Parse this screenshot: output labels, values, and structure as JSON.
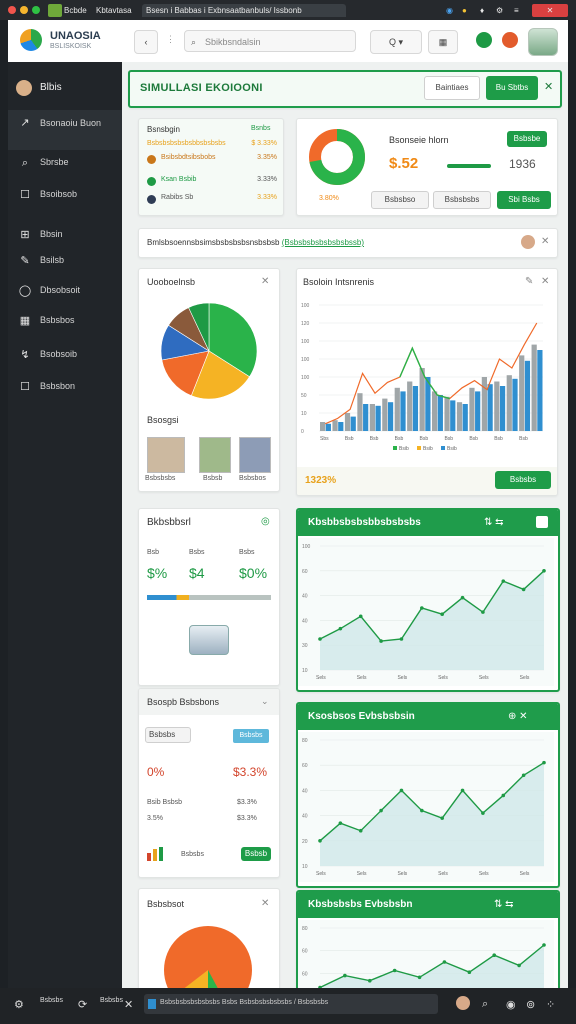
{
  "browser": {
    "tabs": [
      "Bcbde",
      "Kbtavtasa",
      "Bsesn i Babbas i Exbnsaatbanbuls/ Issbonb"
    ],
    "right_icons": [
      "globe-icon",
      "github-icon",
      "bell-icon",
      "settings-icon",
      "menu-icon"
    ],
    "window_close": "✕"
  },
  "app": {
    "logo_title": "UNAOSIA",
    "logo_subtitle": "BSLISKOISK",
    "back_label": "‹",
    "search_placeholder": "Sbikbsndalsin",
    "filter_label": "Q ▾",
    "grid_label": "▦",
    "header_icons": [
      "person-icon",
      "help-icon",
      "car-avatar"
    ]
  },
  "sidebar": {
    "user_label": "Blbis",
    "items": [
      {
        "label": "Bsonaoiu Buon",
        "icon": "↗"
      },
      {
        "label": "Sbrsbe",
        "icon": "⌕"
      },
      {
        "label": "Bsoibsob",
        "icon": "☐"
      },
      {
        "label": "Bbsin",
        "icon": "⊞"
      },
      {
        "label": "Bsilsb",
        "icon": "✎"
      },
      {
        "label": "Dbsobsoit",
        "icon": "◯"
      },
      {
        "label": "Bsbsbos",
        "icon": "▦"
      },
      {
        "label": "Bsobsoib",
        "icon": "↯"
      },
      {
        "label": "Bsbsbon",
        "icon": "☐"
      }
    ]
  },
  "header_bar": {
    "title": "SIMULLASI EKOIOONI",
    "btn1": "Baintiaes",
    "btn2": "Bu Sbtbs",
    "close": "✕"
  },
  "summary_list": {
    "title": "Bsnsbgin",
    "col": "Bsnbs",
    "rows": [
      {
        "label": "Bsbsbsbsbsbsbbsbsbsbs",
        "value": "$ 3.33%",
        "color": "#e8a21c"
      },
      {
        "label": "Bsibsbdtsibsbobs",
        "value": "3.35%",
        "color": "#c9771a"
      },
      {
        "label": "Ksan Bsbib",
        "value": "3.33%",
        "color": "#1e9a45"
      },
      {
        "label": "Rabibs Sb",
        "value": "3.33%",
        "color": "#333"
      }
    ]
  },
  "kpi_card": {
    "title": "Bsonseie hlorn",
    "value": "$.52",
    "right_value": "1936",
    "button": "Bsbsbe",
    "donut_label": "3.80%",
    "actions": [
      "Bsbsbso",
      "Bsbsbsbs",
      "Sbi Bsbs"
    ],
    "donut_fraction": 0.72
  },
  "notification": {
    "text": "Bmlsbsoennsbsimsbsbsbsbsnsbsbsb",
    "link": "(Bsbsbsbsbsbsbsbssb)",
    "close": "✕"
  },
  "pie_card": {
    "title": "Uooboelnsb",
    "close": "✕",
    "subtitle": "Bsosgsi",
    "people": [
      "Bsbsbsbs",
      "Bsbsb",
      "Bsbsbos"
    ],
    "slices": [
      {
        "value": 34,
        "color": "#2ab34a"
      },
      {
        "value": 22,
        "color": "#f5b324"
      },
      {
        "value": 16,
        "color": "#f06a2a"
      },
      {
        "value": 12,
        "color": "#2f6cc0"
      },
      {
        "value": 9,
        "color": "#8a5a3b"
      },
      {
        "value": 7,
        "color": "#1e9a45"
      }
    ]
  },
  "combo_chart": {
    "title": "Bsoloin Intsnrenis",
    "footer_value": "1323%",
    "footer_button": "Bsbsbs",
    "legend": [
      "Bsib",
      "Bsib",
      "Bsib"
    ]
  },
  "chart_data": [
    {
      "type": "bar",
      "title": "Bsoloin Intsnrenis",
      "categories": [
        "Sbs",
        "Bsb",
        "Bsb",
        "Bsb",
        "Bsb",
        "Bsb",
        "Bsb",
        "Bsb",
        "Bsb",
        "Bsb",
        "Bsb",
        "Bsb",
        "Bsb",
        "Bsb",
        "Bsb",
        "Bsb",
        "Bsb",
        "Bsb"
      ],
      "series": [
        {
          "values": [
            10,
            12,
            20,
            42,
            30,
            36,
            48,
            55,
            70,
            44,
            38,
            32,
            48,
            60,
            55,
            62,
            84,
            96
          ],
          "color": "#a0a6a8"
        },
        {
          "values": [
            8,
            10,
            16,
            30,
            28,
            32,
            44,
            50,
            60,
            40,
            34,
            30,
            44,
            52,
            50,
            58,
            78,
            90
          ],
          "color": "#2f8fd0"
        }
      ],
      "line": [
        8,
        14,
        24,
        64,
        42,
        54,
        60,
        92,
        60,
        40,
        36,
        48,
        56,
        46,
        80,
        70,
        96,
        120
      ],
      "ylim": [
        0,
        140
      ],
      "yticks": [
        "100",
        "120",
        "100",
        "100",
        "100",
        "50",
        "10",
        "0"
      ]
    },
    {
      "type": "line",
      "title": "Kbsbbsbsbsbbsbsbsbs",
      "x": [
        "Sels",
        "Sels",
        "Sels",
        "Sels",
        "Sels",
        "Sels",
        "Sels",
        "Sels",
        "Sels",
        "Sels",
        "Sels",
        "Sels"
      ],
      "values": [
        30,
        40,
        52,
        28,
        30,
        60,
        54,
        70,
        56,
        86,
        78,
        96
      ],
      "ylim": [
        0,
        120
      ],
      "yticks": [
        "100",
        "60",
        "40",
        "40",
        "30",
        "10"
      ]
    },
    {
      "type": "line",
      "title": "Ksosbsos Evbsbsbsin",
      "x": [
        "Sels",
        "Sels",
        "Sels",
        "Sels",
        "Sels",
        "Sels",
        "Sels",
        "Sels",
        "Sels",
        "Sels",
        "Sels",
        "Sels"
      ],
      "values": [
        20,
        34,
        28,
        44,
        60,
        44,
        38,
        60,
        42,
        56,
        72,
        82
      ],
      "ylim": [
        0,
        100
      ],
      "yticks": [
        "80",
        "60",
        "40",
        "40",
        "20",
        "10"
      ]
    },
    {
      "type": "line",
      "title": "Kbsbsbsbs Evbsbsbn",
      "x": [],
      "values": [
        10,
        24,
        18,
        30,
        22,
        40,
        28,
        48,
        36,
        60
      ],
      "ylim": [
        0,
        80
      ],
      "yticks": [
        "80",
        "60",
        "60",
        "40"
      ]
    }
  ],
  "blockchart_card": {
    "title": "Bkbsbbsrl",
    "badge": "◎",
    "labels": [
      "Bsb",
      "Bsbs",
      "Bsbs"
    ],
    "values": [
      "$%",
      "$4",
      "$0%"
    ],
    "progress": 0.34
  },
  "line_card1": {
    "title": "Kbsbbsbsbsbbsbsbsbs",
    "icons": "⇅ ⇆"
  },
  "line_card2": {
    "title": "Ksosbsos Evbsbsbsin",
    "icons": "⊕ ✕"
  },
  "line_card3": {
    "title": "Kbsbsbsbs Evbsbsbn",
    "icons": "⇅ ⇆"
  },
  "recent_card": {
    "title": "Bsospb Bsbsbons",
    "chip": "Bsbsbs",
    "chip2": "Bsbsbs",
    "left_value": "0%",
    "right_value": "$3.3%",
    "row_label": "Bsib Bsbsb",
    "row_value": "$3.3%",
    "row2_label": "3.5%",
    "row2_value": "$3.3%",
    "mini_label": "Bsbsbs",
    "mini_button": "Bsbsb"
  },
  "bottom_card": {
    "title": "Bsbsbsot",
    "close": "✕"
  },
  "bottom_bar": {
    "items": [
      "Bsbsbs",
      "Bsbsbs"
    ],
    "url": "Bsbsbsbsbsbsbsbs Bsbs Bsbsbsbsbsbsbs / Bsbsbsbs",
    "close": "✕"
  }
}
